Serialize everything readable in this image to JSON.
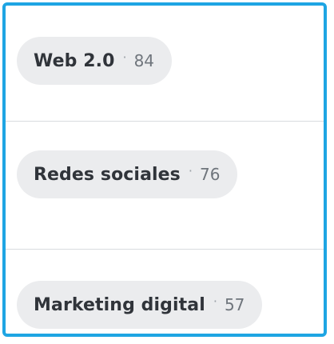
{
  "tags": [
    {
      "label": "Web 2.0",
      "separator": "·",
      "count": "84"
    },
    {
      "label": "Redes sociales",
      "separator": "·",
      "count": "76"
    },
    {
      "label": "Marketing digital",
      "separator": "·",
      "count": "57"
    }
  ],
  "colors": {
    "frame_border": "#1ea5e3",
    "pill_background": "#ebecee",
    "label_text": "#30343a",
    "count_text": "#6f757c",
    "divider": "#d9dcdf"
  }
}
